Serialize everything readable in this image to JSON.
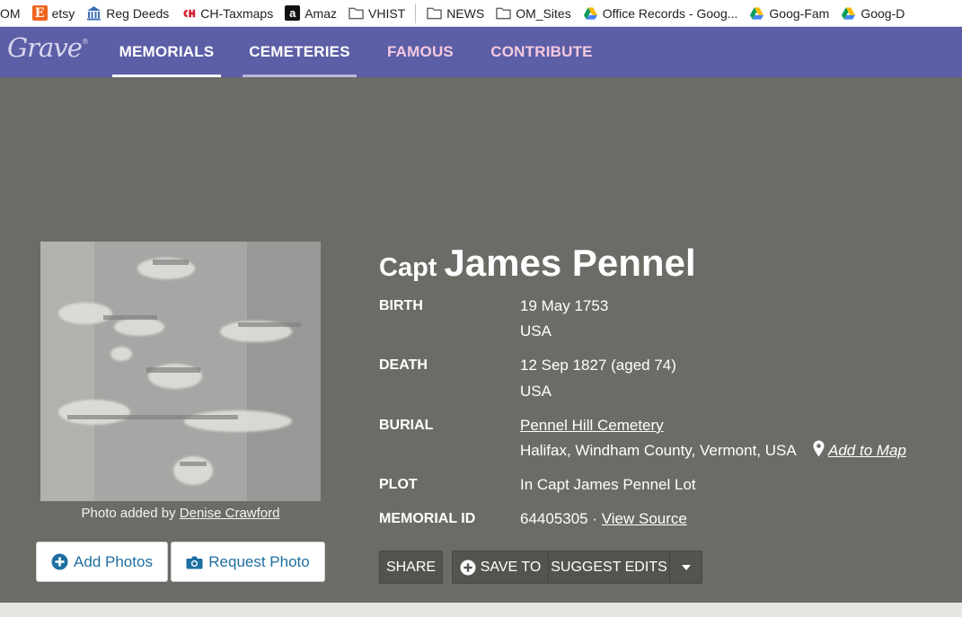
{
  "bookmarks": [
    {
      "label": "OM",
      "icon": "none"
    },
    {
      "label": "etsy",
      "icon": "etsy-icon"
    },
    {
      "label": "Reg Deeds",
      "icon": "building-icon"
    },
    {
      "label": "CH-Taxmaps",
      "icon": "ch-logo-icon"
    },
    {
      "label": "Amaz",
      "icon": "amazon-icon"
    },
    {
      "label": "VHIST",
      "icon": "folder-icon"
    },
    {
      "label": "NEWS",
      "icon": "folder-icon"
    },
    {
      "label": "OM_Sites",
      "icon": "folder-icon"
    },
    {
      "label": "Office Records - Goog...",
      "icon": "drive-icon"
    },
    {
      "label": "Goog-Fam",
      "icon": "drive-icon"
    },
    {
      "label": "Goog-D",
      "icon": "drive-icon"
    }
  ],
  "etsy_glyph": "E",
  "amazon_glyph": "a",
  "nav": {
    "logo": "Grave",
    "logo_mark": "®",
    "tabs": [
      {
        "label": "MEMORIALS",
        "color": "#ffffff",
        "underline": "#ffffff"
      },
      {
        "label": "CEMETERIES",
        "color": "#ffffff",
        "underline": "#b9b8dc"
      },
      {
        "label": "FAMOUS",
        "color": "#f5c9df",
        "underline": ""
      },
      {
        "label": "CONTRIBUTE",
        "color": "#f5c9df",
        "underline": ""
      }
    ]
  },
  "memorial": {
    "prefix": "Capt",
    "name": "James Pennel",
    "photo_credit_prefix": "Photo added by",
    "photo_credit_name": "Denise Crawford",
    "birth_label": "BIRTH",
    "birth_date": "19 May 1753",
    "birth_place": "USA",
    "death_label": "DEATH",
    "death_date": "12 Sep 1827 (aged 74)",
    "death_place": "USA",
    "burial_label": "BURIAL",
    "burial_cemetery": "Pennel Hill Cemetery",
    "burial_place": "Halifax, Windham County, Vermont, USA",
    "add_to_map": "Add to Map",
    "plot_label": "PLOT",
    "plot_value": "In Capt James Pennel Lot",
    "memorial_id_label": "MEMORIAL ID",
    "memorial_id": "64405305",
    "memorial_id_sep": " · ",
    "view_source": "View Source"
  },
  "buttons": {
    "add_photos": "Add Photos",
    "request_photo": "Request Photo",
    "share": "SHARE",
    "save_to": "SAVE TO",
    "suggest_edits": "SUGGEST EDITS"
  },
  "colors": {
    "nav_bg": "#5c5ea6",
    "main_bg": "#6d6b66",
    "button_text": "#1e6fa0"
  }
}
